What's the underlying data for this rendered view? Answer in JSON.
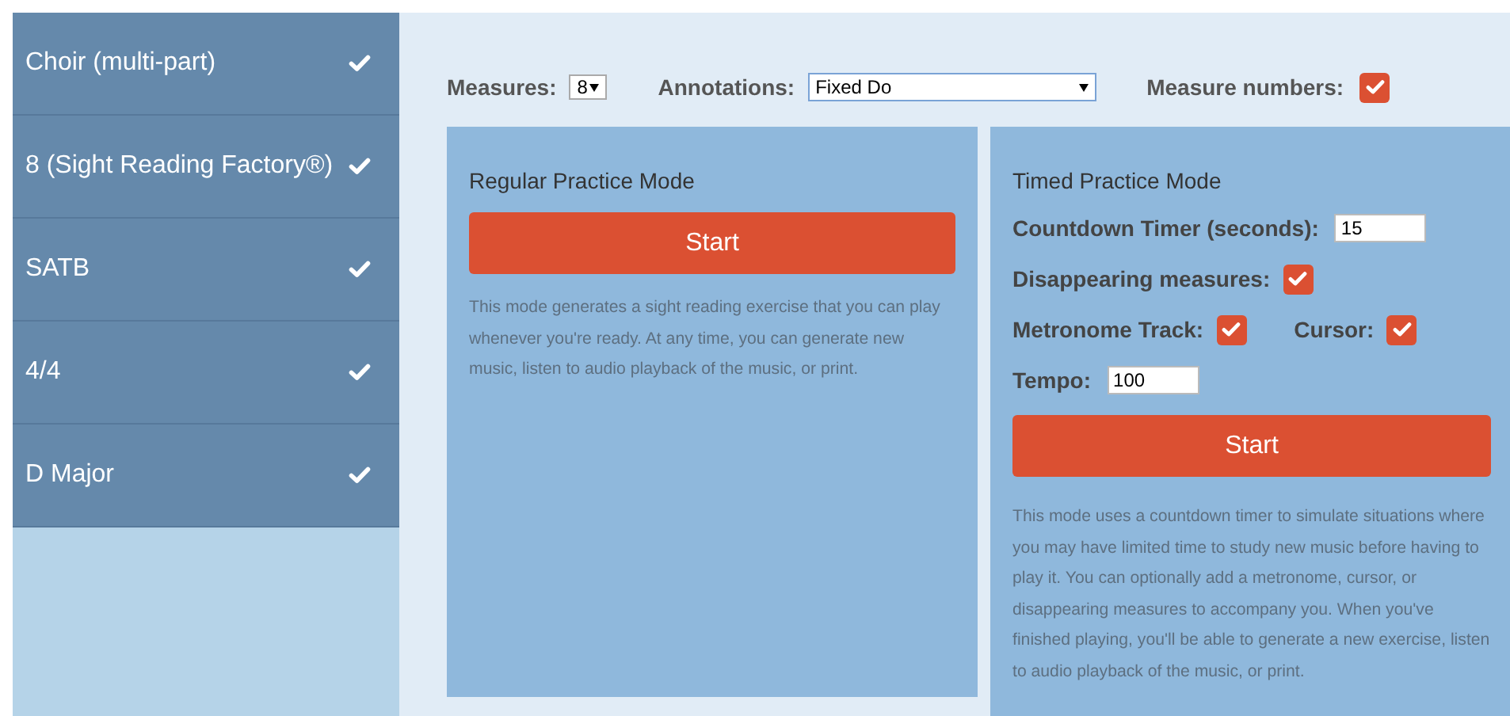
{
  "sidebar": {
    "items": [
      {
        "label": "Choir (multi-part)",
        "checked": true
      },
      {
        "label": "8 (Sight Reading Factory®)",
        "checked": true
      },
      {
        "label": "SATB",
        "checked": true
      },
      {
        "label": "4/4",
        "checked": true
      },
      {
        "label": "D Major",
        "checked": true
      }
    ]
  },
  "settings": {
    "measures": {
      "label": "Measures:",
      "value": "8"
    },
    "annotations": {
      "label": "Annotations:",
      "value": "Fixed Do"
    },
    "measure_numbers": {
      "label": "Measure numbers:",
      "checked": true
    }
  },
  "panels": [
    {
      "title": "Regular Practice Mode",
      "button": "Start",
      "description": "This mode generates a sight reading exercise that you can play whenever you're ready. At any time, you can generate new music, listen to audio playback of the music, or print."
    },
    {
      "title": "Timed Practice Mode",
      "rows": [
        {
          "fields": [
            {
              "kind": "text",
              "label": "Countdown Timer (seconds):",
              "value": "15"
            }
          ]
        },
        {
          "fields": [
            {
              "kind": "checkbox",
              "label": "Disappearing measures:",
              "checked": true
            }
          ]
        },
        {
          "fields": [
            {
              "kind": "checkbox",
              "label": "Metronome Track:",
              "checked": true
            },
            {
              "kind": "checkbox",
              "label": "Cursor:",
              "checked": true
            }
          ]
        },
        {
          "fields": [
            {
              "kind": "text",
              "label": "Tempo:",
              "value": "100"
            }
          ]
        }
      ],
      "button": "Start",
      "description": "This mode uses a countdown timer to simulate situations where you may have limited time to study new music before having to play it. You can optionally add a metronome, cursor, or disappearing measures to accompany you. When you've finished playing, you'll be able to generate a new exercise, listen to audio playback of the music, or print."
    }
  ]
}
